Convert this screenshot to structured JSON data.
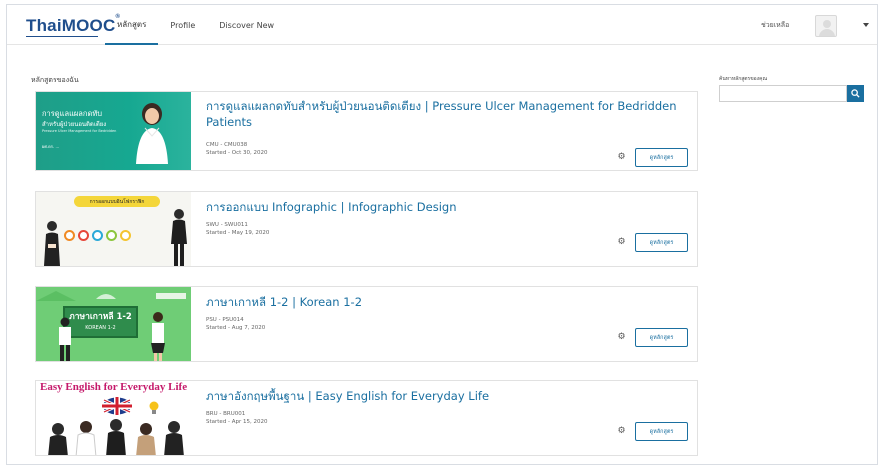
{
  "header": {
    "logo_text": "ThaiMOOC",
    "logo_reg": "®",
    "nav_tabs": [
      {
        "label": "หลักสูตร",
        "active": true
      },
      {
        "label": "Profile",
        "active": false
      },
      {
        "label": "Discover New",
        "active": false
      }
    ],
    "help_label": "ช่วยเหลือ",
    "avatar_icon": "user-avatar-icon",
    "menu_icon": "caret-down-icon"
  },
  "main": {
    "section_title": "หลักสูตรของฉัน",
    "view_button_label": "ดูหลักสูตร",
    "courses": [
      {
        "title": "การดูแลแผลกดทับสำหรับผู้ป่วยนอนติดเตียง | Pressure Ulcer Management for Bedridden Patients",
        "code": "CMU - CMU038",
        "started": "Started - Oct 30, 2020",
        "thumb_lines": [
          "การดูแลแผลกดทับ",
          "สำหรับผู้ป่วยนอนติดเตียง",
          "Pressure Ulcer Management for Bedridden",
          "ผศ.ดร. ..."
        ]
      },
      {
        "title": "การออกแบบ Infographic | Infographic Design",
        "code": "SWU - SWU011",
        "started": "Started - May 19, 2020",
        "thumb_banner": "การออกแบบอินโฟกราฟิก"
      },
      {
        "title": "ภาษาเกาหลี 1-2 | Korean 1-2",
        "code": "PSU - PSU014",
        "started": "Started - Aug 7, 2020",
        "thumb_board": "ภาษาเกาหลี 1-2",
        "thumb_board_sub": "KOREAN 1-2"
      },
      {
        "title": "ภาษาอังกฤษพื้นฐาน | Easy English for Everyday Life",
        "code": "BRU - BRU001",
        "started": "Started - Apr 15, 2020",
        "thumb_headline": "Easy English for Everyday Life"
      }
    ]
  },
  "sidebar": {
    "search_label": "ค้นหาหลักสูตรของคุณ",
    "search_value": "",
    "search_icon": "search-icon"
  },
  "colors": {
    "accent": "#1a6fa0",
    "brand": "#1f4e8c"
  }
}
